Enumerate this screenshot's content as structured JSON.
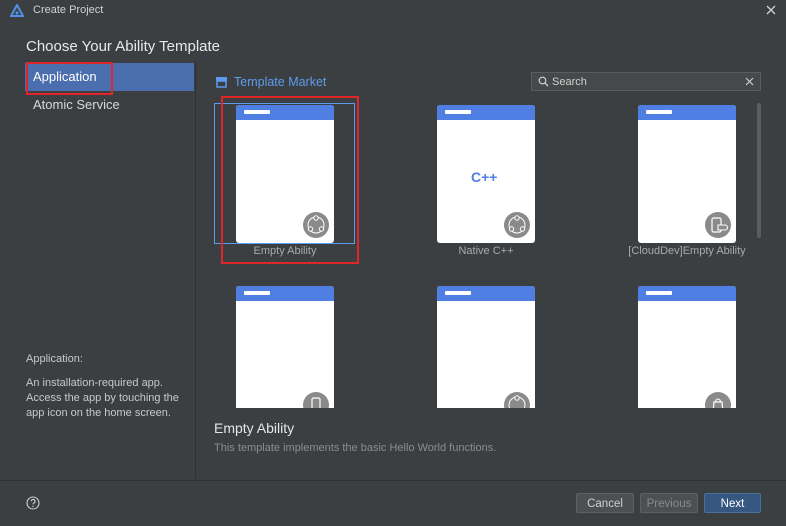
{
  "window": {
    "title": "Create Project"
  },
  "dialog": {
    "title": "Choose Your Ability Template"
  },
  "sidebar": {
    "items": [
      {
        "label": "Application",
        "selected": true
      },
      {
        "label": "Atomic Service",
        "selected": false
      }
    ],
    "description_title": "Application:",
    "description": "An installation-required app. Access the app by touching the app icon on the home screen."
  },
  "market": {
    "label": "Template Market"
  },
  "search": {
    "placeholder": "Search",
    "value": ""
  },
  "templates": [
    {
      "label": "Empty Ability",
      "badge": "nodes-icon",
      "selected": true
    },
    {
      "label": "Native C++",
      "badge": "nodes-icon",
      "center_text": "C++"
    },
    {
      "label": "[CloudDev]Empty Ability",
      "badge": "cloud-device-icon"
    },
    {
      "label": "",
      "badge": "phone-icon"
    },
    {
      "label": "",
      "badge": "nodes-icon"
    },
    {
      "label": "",
      "badge": "bag-icon"
    }
  ],
  "detail": {
    "title": "Empty Ability",
    "description": "This template implements the basic Hello World functions."
  },
  "buttons": {
    "cancel": "Cancel",
    "previous": "Previous",
    "next": "Next"
  },
  "colors": {
    "accent": "#5d9cec",
    "card_header": "#4f7fe3",
    "highlight": "#e0262a",
    "selected_item": "#4b6eaf"
  }
}
